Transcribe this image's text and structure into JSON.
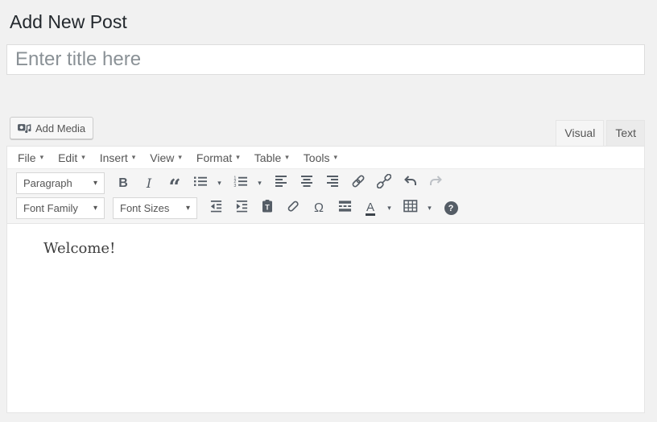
{
  "page": {
    "heading": "Add New Post"
  },
  "title_input": {
    "placeholder": "Enter title here",
    "value": ""
  },
  "media_bar": {
    "add_media_label": "Add Media"
  },
  "editor_tabs": [
    {
      "label": "Visual",
      "active": true
    },
    {
      "label": "Text",
      "active": false
    }
  ],
  "menu_bar": {
    "items": [
      "File",
      "Edit",
      "Insert",
      "View",
      "Format",
      "Table",
      "Tools"
    ]
  },
  "toolbar_row1": {
    "paragraph_dropdown_value": "Paragraph",
    "buttons": [
      "bold",
      "italic",
      "blockquote",
      "bullet-list",
      "numbered-list",
      "align-left",
      "align-center",
      "align-right",
      "link",
      "unlink",
      "undo",
      "redo"
    ]
  },
  "toolbar_row2": {
    "font_family_dropdown_value": "Font Family",
    "font_sizes_dropdown_value": "Font Sizes",
    "buttons": [
      "outdent",
      "indent",
      "paste-as-text",
      "clear-formatting",
      "special-character",
      "insert-read-more",
      "text-color",
      "table",
      "help"
    ]
  },
  "editor_content": {
    "text": "Welcome!"
  },
  "glyphs": {
    "caret": "▾",
    "bold": "B",
    "italic": "I",
    "blockquote": "“",
    "special_character": "Ω",
    "text_color": "A",
    "help": "?"
  },
  "colors": {
    "page_background": "#f1f1f1",
    "heading_text": "#23282d",
    "toolbar_background": "#f5f5f5",
    "editor_border": "#e5e5e5",
    "icon": "#555d66",
    "disabled_icon": "#bdc1c6",
    "button_text": "#555555",
    "placeholder_text": "#8a9196",
    "inactive_tab_background": "#ebebeb"
  }
}
